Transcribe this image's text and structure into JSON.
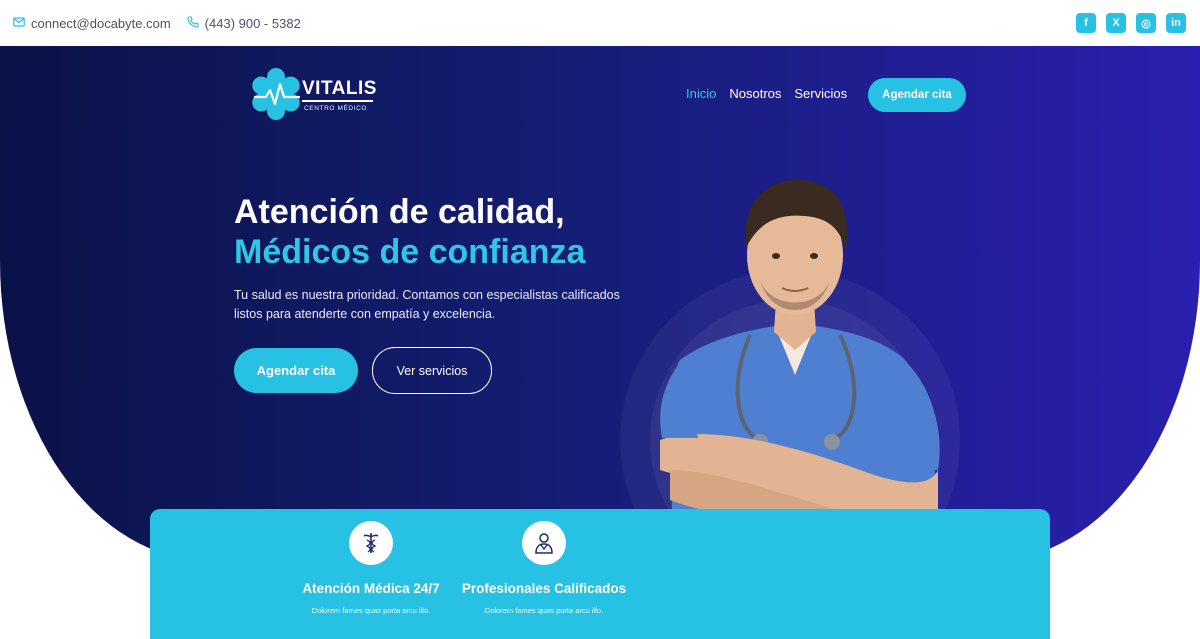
{
  "topbar": {
    "email": "connect@docabyte.com",
    "phone": "(443) 900 - 5382",
    "socials": [
      {
        "icon": "facebook-icon",
        "glyph": "f"
      },
      {
        "icon": "x-twitter-icon",
        "glyph": "X"
      },
      {
        "icon": "instagram-icon",
        "glyph": "◎"
      },
      {
        "icon": "linkedin-icon",
        "glyph": "in"
      }
    ]
  },
  "brand": {
    "name": "VITALIS",
    "tagline": "CENTRO MÉDICO"
  },
  "nav": {
    "items": [
      "Inicio",
      "Nosotros",
      "Servicios"
    ],
    "active": "Inicio",
    "cta": "Agendar cita"
  },
  "hero": {
    "title_line1": "Atención de calidad,",
    "title_line2": "Médicos de confianza",
    "subtitle": "Tu salud es nuestra prioridad. Contamos con especialistas calificados listos para atenderte con empatía y excelencia.",
    "primary_button": "Agendar cita",
    "secondary_button": "Ver servicios"
  },
  "features": [
    {
      "icon": "caduceus-icon",
      "title": "Atención Médica 24/7",
      "text": "Dolorem fames quas porta arcu illo."
    },
    {
      "icon": "doctor-icon",
      "title": "Profesionales Calificados",
      "text": "Dolorem fames quas porta arcu illo."
    }
  ],
  "colors": {
    "accent": "#27c1e3",
    "hero_dark": "#0b1248",
    "hero_light": "#2a1fae"
  }
}
